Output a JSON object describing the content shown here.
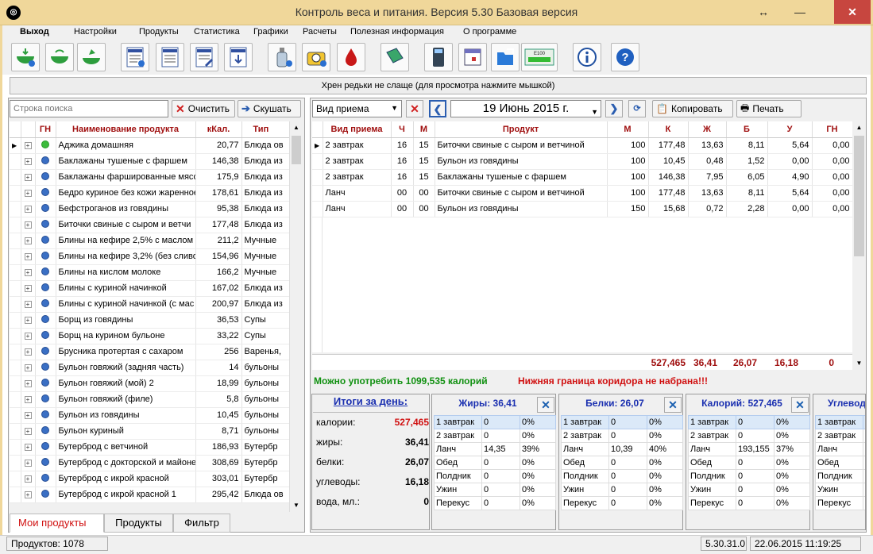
{
  "window": {
    "title": "Контроль веса и питания. Версия 5.30 Базовая версия",
    "minimize": "—",
    "maximize": "↔",
    "close": "✕"
  },
  "menu": [
    "Выход",
    "Настройки",
    "Продукты",
    "Статистика",
    "Графики",
    "Расчеты",
    "Полезная информация",
    "О программе"
  ],
  "tip": "Хрен редьки не слаще (для просмотра нажмите мышкой)",
  "search": {
    "placeholder": "Строка поиска",
    "clear_label": "Очистить",
    "eat_label": "Скушать"
  },
  "products": {
    "headers": [
      "ГН",
      "Наименование продукта",
      "кКал.",
      "Тип"
    ],
    "rows": [
      {
        "name": "Аджика домашняя",
        "kcal": "20,77",
        "type": "Блюда ов",
        "green": true
      },
      {
        "name": "Баклажаны тушеные с фаршем",
        "kcal": "146,38",
        "type": "Блюда из"
      },
      {
        "name": "Баклажаны фаршированные мясо",
        "kcal": "175,9",
        "type": "Блюда из"
      },
      {
        "name": "Бедро куриное без кожи жаренное",
        "kcal": "178,61",
        "type": "Блюда из"
      },
      {
        "name": "Бефстроганов из говядины",
        "kcal": "95,38",
        "type": "Блюда из"
      },
      {
        "name": "Биточки свиные с сыром и ветчи",
        "kcal": "177,48",
        "type": "Блюда из"
      },
      {
        "name": "Блины на кефире 2,5% с маслом",
        "kcal": "211,2",
        "type": "Мучные"
      },
      {
        "name": "Блины на кефире 3,2% (без сливо",
        "kcal": "154,96",
        "type": "Мучные"
      },
      {
        "name": "Блины на кислом молоке",
        "kcal": "166,2",
        "type": "Мучные"
      },
      {
        "name": "Блины с куриной начинкой",
        "kcal": "167,02",
        "type": "Блюда из"
      },
      {
        "name": "Блины с куриной начинкой (с мас",
        "kcal": "200,97",
        "type": "Блюда из"
      },
      {
        "name": "Борщ из говядины",
        "kcal": "36,53",
        "type": "Супы"
      },
      {
        "name": "Борщ на курином бульоне",
        "kcal": "33,22",
        "type": "Супы"
      },
      {
        "name": "Брусника протертая с сахаром",
        "kcal": "256",
        "type": "Варенья,"
      },
      {
        "name": "Бульон говяжий (задняя часть)",
        "kcal": "14",
        "type": "бульоны"
      },
      {
        "name": "Бульон говяжий (мой) 2",
        "kcal": "18,99",
        "type": "бульоны"
      },
      {
        "name": "Бульон говяжий (филе)",
        "kcal": "5,8",
        "type": "бульоны"
      },
      {
        "name": "Бульон из говядины",
        "kcal": "10,45",
        "type": "бульоны"
      },
      {
        "name": "Бульон куриный",
        "kcal": "8,71",
        "type": "бульоны"
      },
      {
        "name": "Бутерброд с ветчиной",
        "kcal": "186,93",
        "type": "Бутербр"
      },
      {
        "name": "Бутерброд с докторской и майоне",
        "kcal": "308,69",
        "type": "Бутербр"
      },
      {
        "name": "Бутерброд с икрой красной",
        "kcal": "303,01",
        "type": "Бутербр"
      },
      {
        "name": "Бутерброд с икрой красной 1",
        "kcal": "295,42",
        "type": "Блюда ов"
      }
    ]
  },
  "tabs": [
    "Мои продукты",
    "Продукты",
    "Фильтр"
  ],
  "diary": {
    "meal_select": "Вид приема",
    "date": "19 Июнь 2015 г.",
    "copy_label": "Копировать",
    "print_label": "Печать",
    "headers": [
      "Вид приема",
      "Ч",
      "М",
      "Продукт",
      "М",
      "К",
      "Ж",
      "Б",
      "У",
      "ГН"
    ],
    "rows": [
      [
        "2 завтрак",
        "16",
        "15",
        "Биточки свиные с сыром и ветчиной",
        "100",
        "177,48",
        "13,63",
        "8,11",
        "5,64",
        "0,00"
      ],
      [
        "2 завтрак",
        "16",
        "15",
        "Бульон из говядины",
        "100",
        "10,45",
        "0,48",
        "1,52",
        "0,00",
        "0,00"
      ],
      [
        "2 завтрак",
        "16",
        "15",
        "Баклажаны тушеные с фаршем",
        "100",
        "146,38",
        "7,95",
        "6,05",
        "4,90",
        "0,00"
      ],
      [
        "Ланч",
        "00",
        "00",
        "Биточки свиные с сыром и ветчиной",
        "100",
        "177,48",
        "13,63",
        "8,11",
        "5,64",
        "0,00"
      ],
      [
        "Ланч",
        "00",
        "00",
        "Бульон из говядины",
        "150",
        "15,68",
        "0,72",
        "2,28",
        "0,00",
        "0,00"
      ]
    ],
    "totals": {
      "k": "527,465",
      "f": "36,41",
      "p": "26,07",
      "c": "16,18",
      "gn": "0"
    }
  },
  "messages": {
    "can_eat": "Можно употребить 1099,535 калорий",
    "corridor": "Нижняя граница коридора не набрана!!!"
  },
  "summary": {
    "title": "Итоги за день:",
    "items": [
      {
        "label": "калории:",
        "value": "527,465"
      },
      {
        "label": "жиры:",
        "value": "36,41"
      },
      {
        "label": "белки:",
        "value": "26,07"
      },
      {
        "label": "углеводы:",
        "value": "16,18"
      },
      {
        "label": "вода, мл.:",
        "value": "0"
      }
    ]
  },
  "breakdowns": [
    {
      "title": "Жиры: 36,41",
      "rows": [
        [
          "1 завтрак",
          "0",
          "0%"
        ],
        [
          "2 завтрак",
          "0",
          "0%"
        ],
        [
          "Ланч",
          "14,35",
          "39%"
        ],
        [
          "Обед",
          "0",
          "0%"
        ],
        [
          "Полдник",
          "0",
          "0%"
        ],
        [
          "Ужин",
          "0",
          "0%"
        ],
        [
          "Перекус",
          "0",
          "0%"
        ]
      ]
    },
    {
      "title": "Белки: 26,07",
      "rows": [
        [
          "1 завтрак",
          "0",
          "0%"
        ],
        [
          "2 завтрак",
          "0",
          "0%"
        ],
        [
          "Ланч",
          "10,39",
          "40%"
        ],
        [
          "Обед",
          "0",
          "0%"
        ],
        [
          "Полдник",
          "0",
          "0%"
        ],
        [
          "Ужин",
          "0",
          "0%"
        ],
        [
          "Перекус",
          "0",
          "0%"
        ]
      ]
    },
    {
      "title": "Калорий: 527,465",
      "rows": [
        [
          "1 завтрак",
          "0",
          "0%"
        ],
        [
          "2 завтрак",
          "0",
          "0%"
        ],
        [
          "Ланч",
          "193,155",
          "37%"
        ],
        [
          "Обед",
          "0",
          "0%"
        ],
        [
          "Полдник",
          "0",
          "0%"
        ],
        [
          "Ужин",
          "0",
          "0%"
        ],
        [
          "Перекус",
          "0",
          "0%"
        ]
      ]
    },
    {
      "title": "Углевод",
      "rows": [
        [
          "1 завтрак",
          "",
          ""
        ],
        [
          "2 завтрак",
          "",
          ""
        ],
        [
          "Ланч",
          "",
          ""
        ],
        [
          "Обед",
          "",
          ""
        ],
        [
          "Полдник",
          "",
          ""
        ],
        [
          "Ужин",
          "",
          ""
        ],
        [
          "Перекус",
          "",
          ""
        ]
      ]
    }
  ],
  "status": {
    "products_count": "Продуктов: 1078",
    "version": "5.30.31.0",
    "datetime": "22.06.2015 11:19:25"
  },
  "colors": {
    "title_bar": "#f0d79a",
    "header_text": "#a01010",
    "accent_blue": "#1a2fb0",
    "green_msg": "#109010",
    "red_msg": "#d01010",
    "close": "#c7463f"
  }
}
